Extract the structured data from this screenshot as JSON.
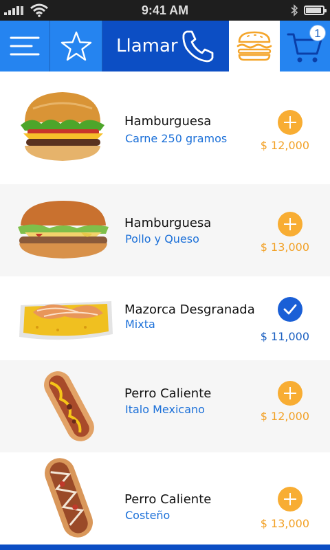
{
  "status_bar": {
    "time": "9:41 AM",
    "icons": [
      "signal-icon",
      "wifi-icon",
      "bluetooth-icon",
      "battery-icon"
    ]
  },
  "toolbar": {
    "menu_icon": "hamburger-menu-icon",
    "favorites_icon": "star-icon",
    "call_label": "Llamar",
    "call_icon": "phone-icon",
    "category_icon": "burger-icon",
    "cart_icon": "cart-icon",
    "cart_count": "1"
  },
  "colors": {
    "primary_blue": "#2584f0",
    "dark_blue": "#0c4ec4",
    "accent_orange": "#f8ad33",
    "link_blue": "#1a6fd8"
  },
  "products": [
    {
      "name": "Hamburguesa",
      "detail": "Carne 250 gramos",
      "price": "$ 12,000",
      "state": "add"
    },
    {
      "name": "Hamburguesa",
      "detail": "Pollo y Queso",
      "price": "$ 13,000",
      "state": "add"
    },
    {
      "name": "Mazorca Desgranada",
      "detail": "Mixta",
      "price": "$ 11,000",
      "state": "added"
    },
    {
      "name": "Perro Caliente",
      "detail": "Italo Mexicano",
      "price": "$ 12,000",
      "state": "add"
    },
    {
      "name": "Perro Caliente",
      "detail": "Costeño",
      "price": "$ 13,000",
      "state": "add"
    }
  ]
}
